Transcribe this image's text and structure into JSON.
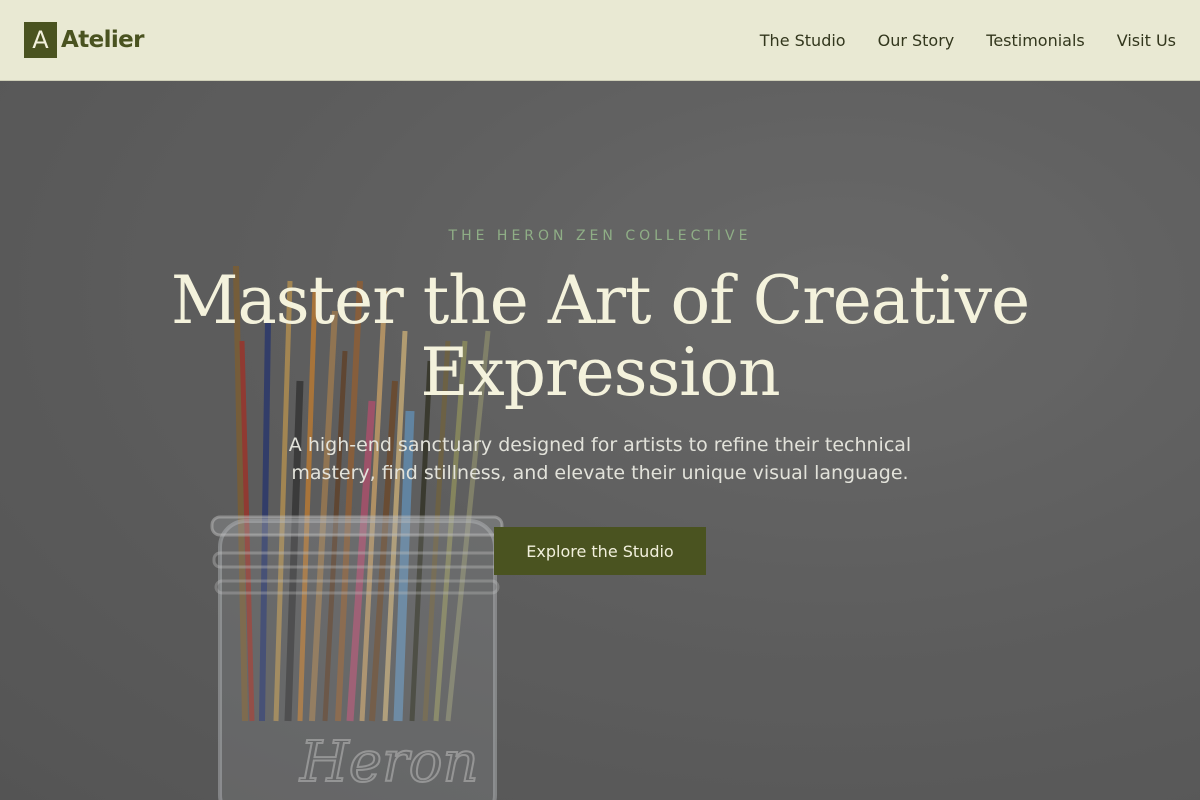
{
  "header": {
    "brand_mark": "A",
    "brand_name": "Atelier",
    "nav": [
      {
        "label": "The Studio"
      },
      {
        "label": "Our Story"
      },
      {
        "label": "Testimonials"
      },
      {
        "label": "Visit Us"
      }
    ]
  },
  "hero": {
    "eyebrow": "THE HERON ZEN COLLECTIVE",
    "headline": "Master the Art of Creative Expression",
    "subtext": "A high-end sanctuary designed for artists to refine their technical mastery, find stillness, and elevate their unique visual language.",
    "cta_label": "Explore the Studio",
    "image_jar_text": "Heron"
  },
  "colors": {
    "header_bg": "#e9e9d3",
    "brand": "#4a5320",
    "eyebrow": "#8fae86",
    "headline": "#f4f2dc"
  }
}
